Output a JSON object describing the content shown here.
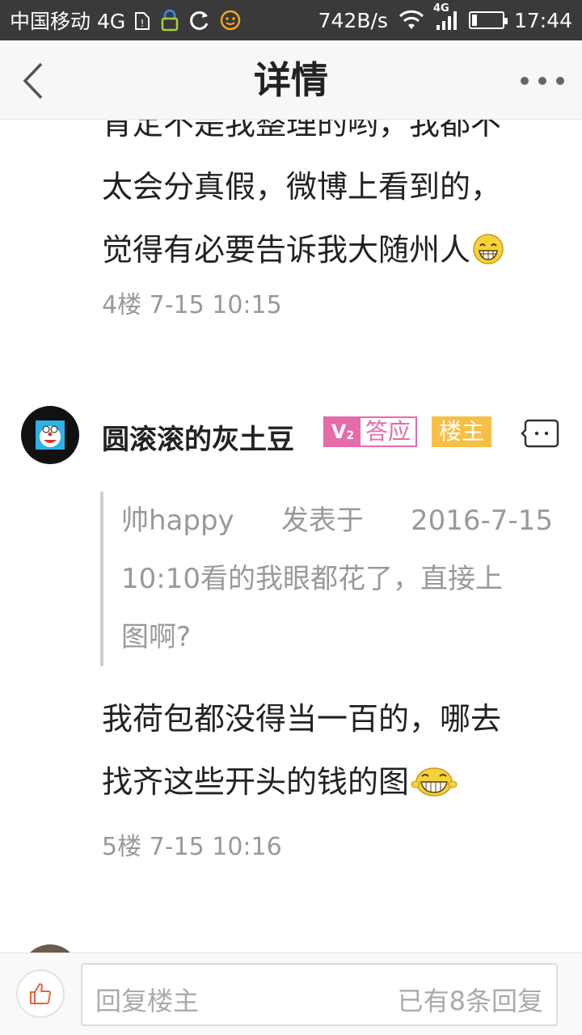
{
  "status_bar": {
    "carrier": "中国移动 4G",
    "speed": "742B/s",
    "network": "4G",
    "time": "17:44"
  },
  "nav": {
    "title": "详情"
  },
  "post4": {
    "text_line_partial": "肯定不是我整理的哟，我都不",
    "text_line2": "太会分真假，微博上看到的，",
    "text_line3": "觉得有必要告诉我大随州人",
    "emoji": "grin-emoji",
    "meta": "4楼 7-15 10:15"
  },
  "post5": {
    "username": "圆滚滚的灰土豆",
    "badge_level": "V",
    "badge_level_sub": "2",
    "badge_title": "答应",
    "badge_host": "楼主",
    "quote_user": "帅happy",
    "quote_posted": "发表于",
    "quote_date": "2016-7-15",
    "quote_line2": "10:10看的我眼都花了，直接上",
    "quote_line3": "图啊?",
    "text_line1": "我荷包都没得当一百的，哪去",
    "text_line2": "找齐这些开头的钱的图",
    "emoji": "laugh-emoji",
    "meta": "5楼 7-15 10:16"
  },
  "bottom": {
    "reply_placeholder": "回复楼主",
    "reply_count": "已有8条回复"
  },
  "colors": {
    "status_bar": "#3a3a3a",
    "badge_pink": "#e56ba9",
    "badge_host": "#f7bf45",
    "like_icon": "#e8643c",
    "meta_text": "#999999"
  }
}
